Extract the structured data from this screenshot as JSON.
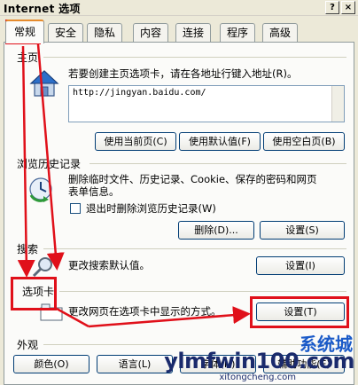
{
  "window": {
    "title": "Internet 选项",
    "help": "?",
    "close": "×"
  },
  "tabs": [
    "常规",
    "安全",
    "隐私",
    "内容",
    "连接",
    "程序",
    "高级"
  ],
  "home": {
    "group": "主页",
    "description": "若要创建主页选项卡，请在各地址行键入地址(R)。",
    "url": "http://jingyan.baidu.com/",
    "buttons": [
      "使用当前页(C)",
      "使用默认值(F)",
      "使用空白页(B)"
    ]
  },
  "history": {
    "group": "浏览历史记录",
    "description_1": "删除临时文件、历史记录、Cookie、保存的密码和网页",
    "description_2": "表单信息。",
    "checkbox_label": "退出时删除浏览历史记录(W)",
    "checkbox_checked": false,
    "buttons": [
      "删除(D)...",
      "设置(S)"
    ]
  },
  "search": {
    "group": "搜索",
    "description": "更改搜索默认值。",
    "button": "设置(I)"
  },
  "tabs_section": {
    "group": "选项卡",
    "description": "更改网页在选项卡中显示的方式。",
    "button": "设置(T)"
  },
  "appearance": {
    "group": "外观",
    "buttons": [
      "颜色(O)",
      "语言(L)",
      "字体(N)",
      "辅助功能(E)"
    ]
  },
  "watermark": {
    "text": "ylmfwin100.com",
    "brand": "系统城",
    "sub": "xitongcheng.com"
  },
  "annotation_color": "#e0101a"
}
